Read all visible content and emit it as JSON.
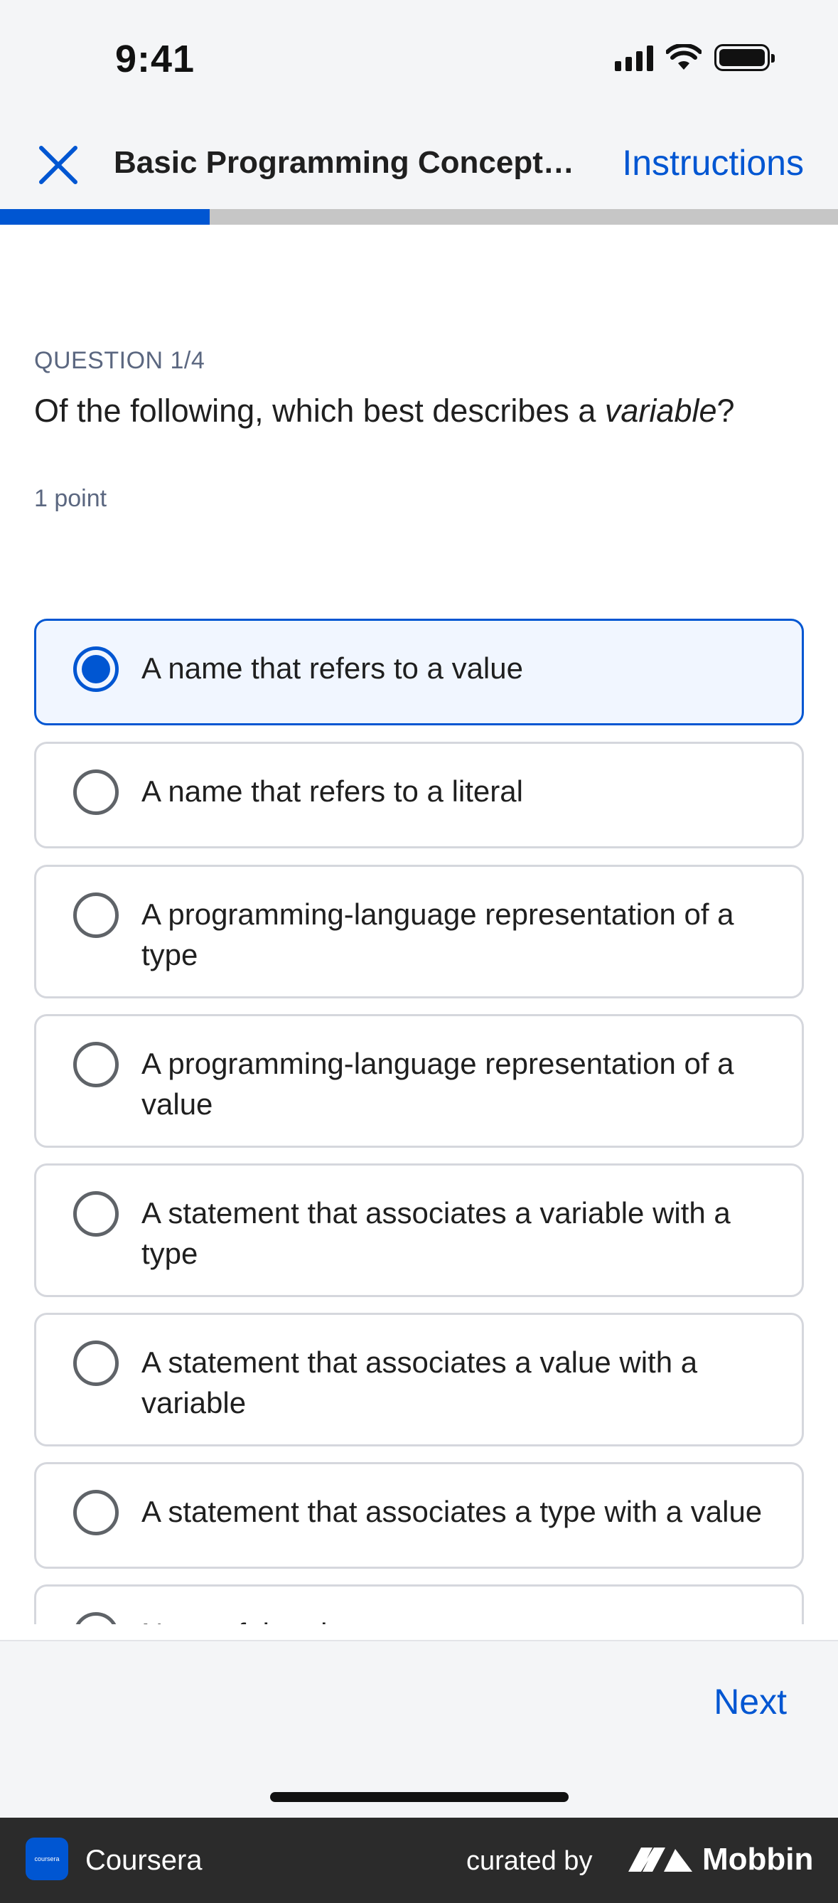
{
  "status_bar": {
    "time": "9:41"
  },
  "nav": {
    "title": "Basic Programming Concepts -...",
    "instructions_label": "Instructions",
    "close_icon": "close-icon"
  },
  "progress": {
    "fraction": 0.25
  },
  "question": {
    "counter": "QUESTION 1/4",
    "text_before": "Of the following, which best describes a ",
    "text_emphasis": "variable",
    "text_after": "?",
    "points": "1 point"
  },
  "options": [
    {
      "label": "A name that refers to a value",
      "selected": true
    },
    {
      "label": "A name that refers to a literal",
      "selected": false
    },
    {
      "label": "A programming-language representation of a type",
      "selected": false
    },
    {
      "label": "A programming-language representation of a value",
      "selected": false
    },
    {
      "label": "A statement that associates a variable with a type",
      "selected": false
    },
    {
      "label": "A statement that associates a value with a variable",
      "selected": false
    },
    {
      "label": "A statement that associates a type with a value",
      "selected": false
    },
    {
      "label": "None of the above",
      "selected": false
    }
  ],
  "footer": {
    "next_label": "Next"
  },
  "brand_bar": {
    "app_name": "Coursera",
    "app_logo_text": "coursera",
    "curated_by": "curated by",
    "mobbin": "Mobbin"
  },
  "colors": {
    "accent": "#0056d2",
    "selected_bg": "#f1f6ff",
    "border": "#d5d7dd"
  }
}
